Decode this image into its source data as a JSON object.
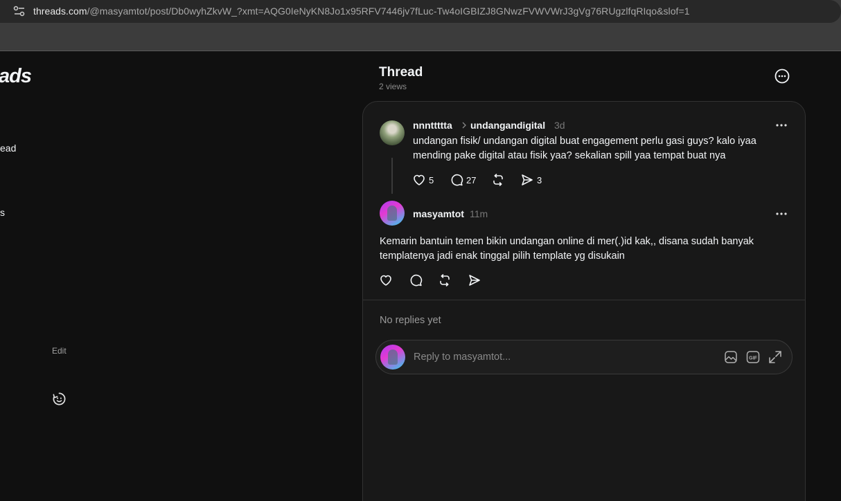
{
  "browser": {
    "url_host": "threads.com",
    "url_path": "/@masyamtot/post/Db0wyhZkvW_?xmt=AQG0IeNyKN8Jo1x95RFV7446jv7fLuc-Tw4oIGBIZJ8GNwzFVWVWrJ3gVg76RUgzlfqRIqo&slof=1"
  },
  "sidebar": {
    "logo_fragment": "ads",
    "nav_fragment_1": "ead",
    "nav_fragment_2": "s",
    "edit_label": "Edit"
  },
  "header": {
    "title": "Thread",
    "views": "2 views"
  },
  "original_post": {
    "username": "nnnttttta",
    "topic": "undangandigital",
    "time": "3d",
    "text": "undangan fisik/ undangan digital buat engagement perlu gasi guys? kalo iyaa mending pake digital atau fisik yaa? sekalian spill yaa tempat buat nya",
    "likes": "5",
    "replies": "27",
    "shares": "3"
  },
  "reply_post": {
    "username": "masyamtot",
    "time": "11m",
    "text": "Kemarin bantuin temen bikin undangan online di mer(.)id kak,, disana sudah banyak templatenya jadi enak tinggal pilih template yg disukain"
  },
  "replies_section": {
    "empty_text": "No replies yet"
  },
  "reply_composer": {
    "placeholder": "Reply to masyamtot..."
  },
  "icons": {
    "site": "site-info-icon",
    "more": "more-horizontal-icon",
    "like": "heart-icon",
    "comment": "comment-icon",
    "repost": "repost-icon",
    "share": "send-icon",
    "media": "image-icon",
    "gif": "gif-icon",
    "expand": "expand-icon",
    "feedback": "feedback-face-icon"
  }
}
